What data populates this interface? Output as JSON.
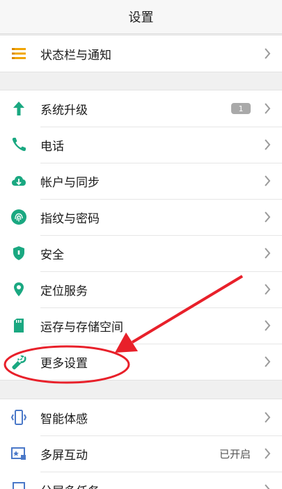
{
  "header": {
    "title": "设置"
  },
  "groups": [
    {
      "items": [
        {
          "label": "状态栏与通知",
          "icon": "list-icon"
        }
      ]
    },
    {
      "items": [
        {
          "label": "系统升级",
          "icon": "arrow-up-icon",
          "badge": "1"
        },
        {
          "label": "电话",
          "icon": "phone-icon"
        },
        {
          "label": "帐户与同步",
          "icon": "cloud-sync-icon"
        },
        {
          "label": "指纹与密码",
          "icon": "fingerprint-icon"
        },
        {
          "label": "安全",
          "icon": "shield-icon"
        },
        {
          "label": "定位服务",
          "icon": "location-pin-icon"
        },
        {
          "label": "运存与存储空间",
          "icon": "sd-card-icon"
        },
        {
          "label": "更多设置",
          "icon": "wrench-icon"
        }
      ]
    },
    {
      "items": [
        {
          "label": "智能体感",
          "icon": "phone-motion-icon"
        },
        {
          "label": "多屏互动",
          "icon": "screen-cast-icon",
          "value": "已开启"
        },
        {
          "label": "分屏多任务",
          "icon": "split-screen-icon"
        }
      ]
    }
  ],
  "colors": {
    "accent": "#1aa881",
    "annotation": "#e8202a",
    "multi_icon": "#4a78c8"
  }
}
